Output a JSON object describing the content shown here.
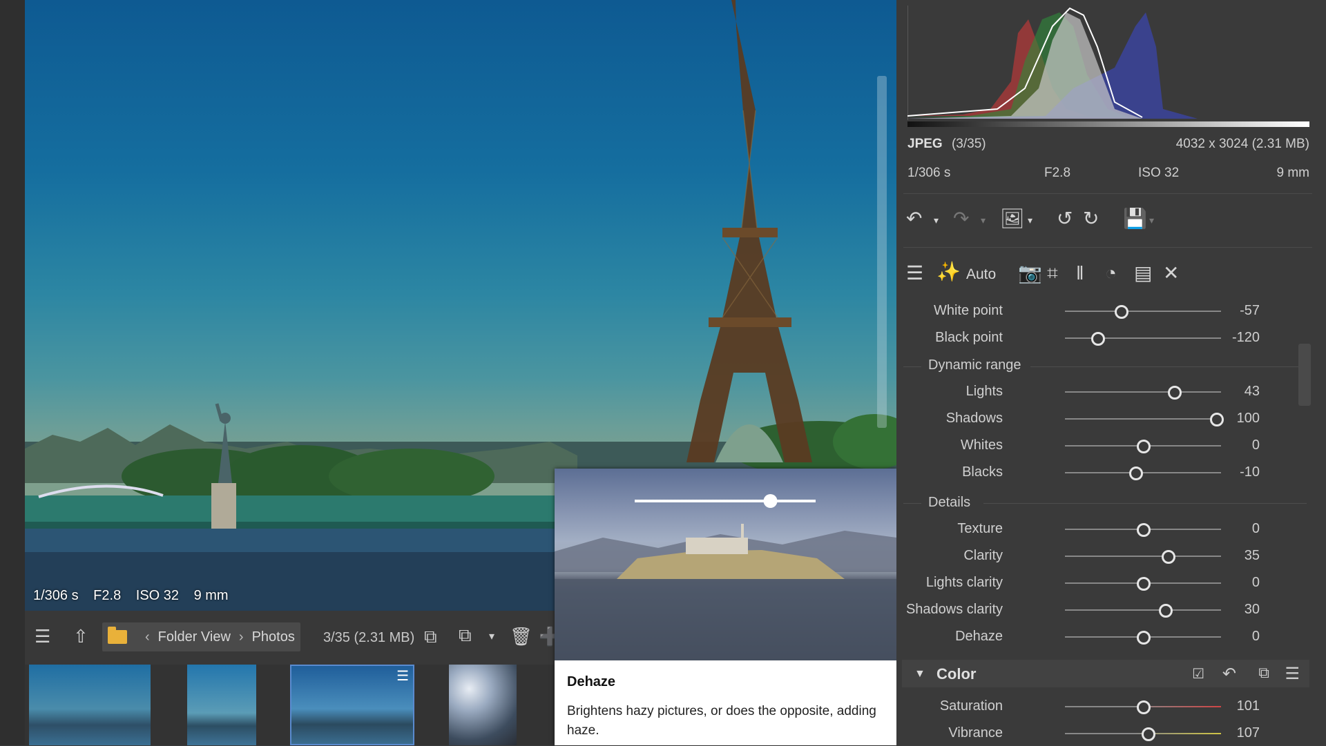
{
  "photo": {
    "info": [
      "1/306 s",
      "F2.8",
      "ISO 32",
      "9 mm"
    ]
  },
  "browser": {
    "breadcrumb": [
      "Folder View",
      "Photos"
    ],
    "count": "3/35 (2.31 MB)"
  },
  "popup": {
    "title": "Dehaze",
    "description": "Brightens hazy pictures, or does the opposite, adding haze.",
    "demo_slider": 0.75
  },
  "panel": {
    "file_type": "JPEG",
    "file_index": "(3/35)",
    "dimensions": "4032 x 3024 (2.31 MB)",
    "exif": {
      "shutter": "1/306 s",
      "aperture": "F2.8",
      "iso": "ISO 32",
      "focal": "9 mm"
    },
    "tool_auto_label": "Auto",
    "tone": [
      {
        "label": "White point",
        "value": "-57",
        "pos": 0.36
      },
      {
        "label": "Black point",
        "value": "-120",
        "pos": 0.21
      }
    ],
    "dynamic_range_title": "Dynamic range",
    "dynamic_range": [
      {
        "label": "Lights",
        "value": "43",
        "pos": 0.7
      },
      {
        "label": "Shadows",
        "value": "100",
        "pos": 0.97
      },
      {
        "label": "Whites",
        "value": "0",
        "pos": 0.5
      },
      {
        "label": "Blacks",
        "value": "-10",
        "pos": 0.45
      }
    ],
    "details_title": "Details",
    "details": [
      {
        "label": "Texture",
        "value": "0",
        "pos": 0.5
      },
      {
        "label": "Clarity",
        "value": "35",
        "pos": 0.66
      },
      {
        "label": "Lights clarity",
        "value": "0",
        "pos": 0.5
      },
      {
        "label": "Shadows clarity",
        "value": "30",
        "pos": 0.64
      },
      {
        "label": "Dehaze",
        "value": "0",
        "pos": 0.5
      }
    ],
    "color_title": "Color",
    "color": [
      {
        "label": "Saturation",
        "value": "101",
        "pos": 0.5,
        "track": "#d04545"
      },
      {
        "label": "Vibrance",
        "value": "107",
        "pos": 0.53,
        "track": "#d0c545"
      }
    ]
  }
}
